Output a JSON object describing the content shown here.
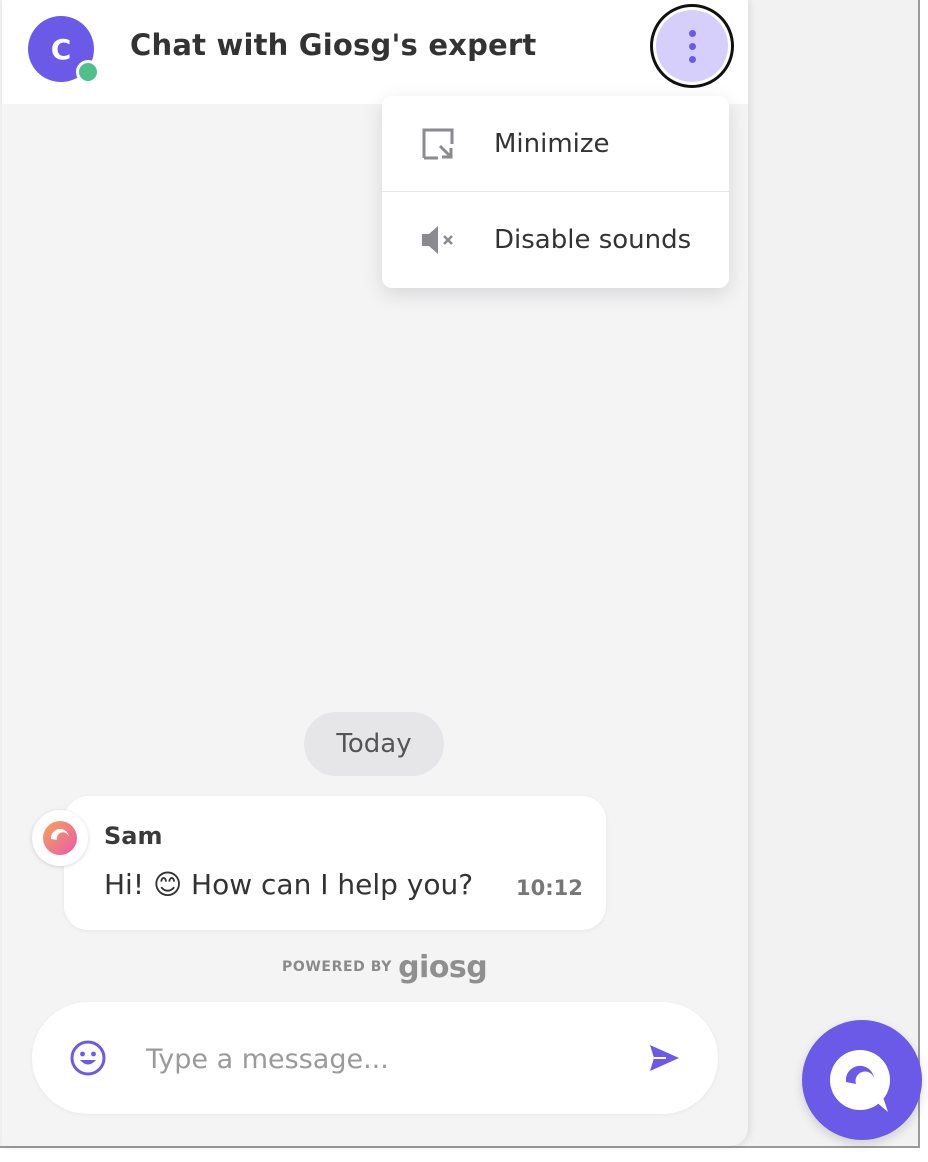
{
  "header": {
    "avatar_initial": "C",
    "title": "Chat with Giosg's expert",
    "menu_button_icon": "kebab-icon"
  },
  "menu": {
    "items": [
      {
        "label": "Minimize",
        "icon": "minimize-icon"
      },
      {
        "label": "Disable sounds",
        "icon": "sound-muted-icon"
      }
    ]
  },
  "conversation": {
    "date_separator": "Today",
    "messages": [
      {
        "sender": "Sam",
        "text": "Hi! 😊 How can I help you?",
        "time": "10:12"
      }
    ]
  },
  "branding": {
    "powered_by": "POWERED BY",
    "logo": "giosg"
  },
  "composer": {
    "placeholder": "Type a message..."
  },
  "colors": {
    "accent": "#6b5ae8",
    "accent_light": "#d6cffc",
    "online": "#4fc08d",
    "background": "#f4f4f5"
  }
}
